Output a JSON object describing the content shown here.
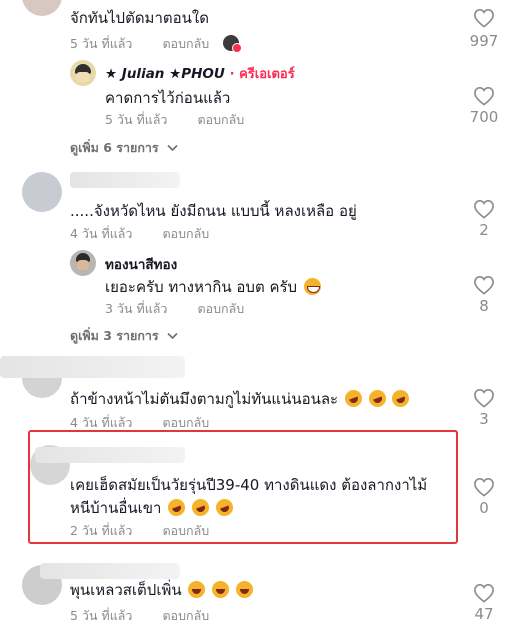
{
  "comments": [
    {
      "text": "จักทันไปตัดมาตอนใด",
      "time": "5 วัน ที่แล้ว",
      "reply": "ตอบกลับ",
      "likes": "997",
      "reply_item": {
        "name": "★ Julian ★PHOU",
        "badge": "· ครีเอเตอร์",
        "text": "คาดการไว้ก่อนแล้ว",
        "time": "5 วัน ที่แล้ว",
        "reply": "ตอบกลับ",
        "likes": "700"
      },
      "more": "ดูเพิ่ม 6 รายการ"
    },
    {
      "text": ".....จังหวัดไหน ยังมีถนน แบบนี้ หลงเหลือ อยู่",
      "time": "4 วัน ที่แล้ว",
      "reply": "ตอบกลับ",
      "likes": "2",
      "reply_item": {
        "name": "ทองนาสีทอง",
        "text": "เยอะครับ ทางหากิน อบต ครับ",
        "time": "3 วัน ที่แล้ว",
        "reply": "ตอบกลับ",
        "likes": "8"
      },
      "more": "ดูเพิ่ม 3 รายการ"
    },
    {
      "text": "ถ้าข้างหน้าไม่ตันมึงตามกูไม่ทันแน่นอนละ",
      "time": "4 วัน ที่แล้ว",
      "reply": "ตอบกลับ",
      "likes": "3"
    },
    {
      "text_line1": "เคยเฮ็ดสมัยเป็นวัยรุ่นปี39-40 ทางดินแดง ต้องลากงาไม้",
      "text_line2": "หนีบ้านอื่นเขา",
      "time": "2 วัน ที่แล้ว",
      "reply": "ตอบกลับ",
      "likes": "0"
    },
    {
      "text": "พุนเหลวสเต็ปเพิ่น",
      "time": "5 วัน ที่แล้ว",
      "reply": "ตอบกลับ",
      "likes": "47"
    }
  ],
  "icons": {
    "like": "heart-outline-icon",
    "chevron": "chevron-down-icon"
  },
  "colors": {
    "creator_badge": "#fe2c55",
    "highlight_border": "#e0363c",
    "meta_gray": "#8a8b91"
  }
}
